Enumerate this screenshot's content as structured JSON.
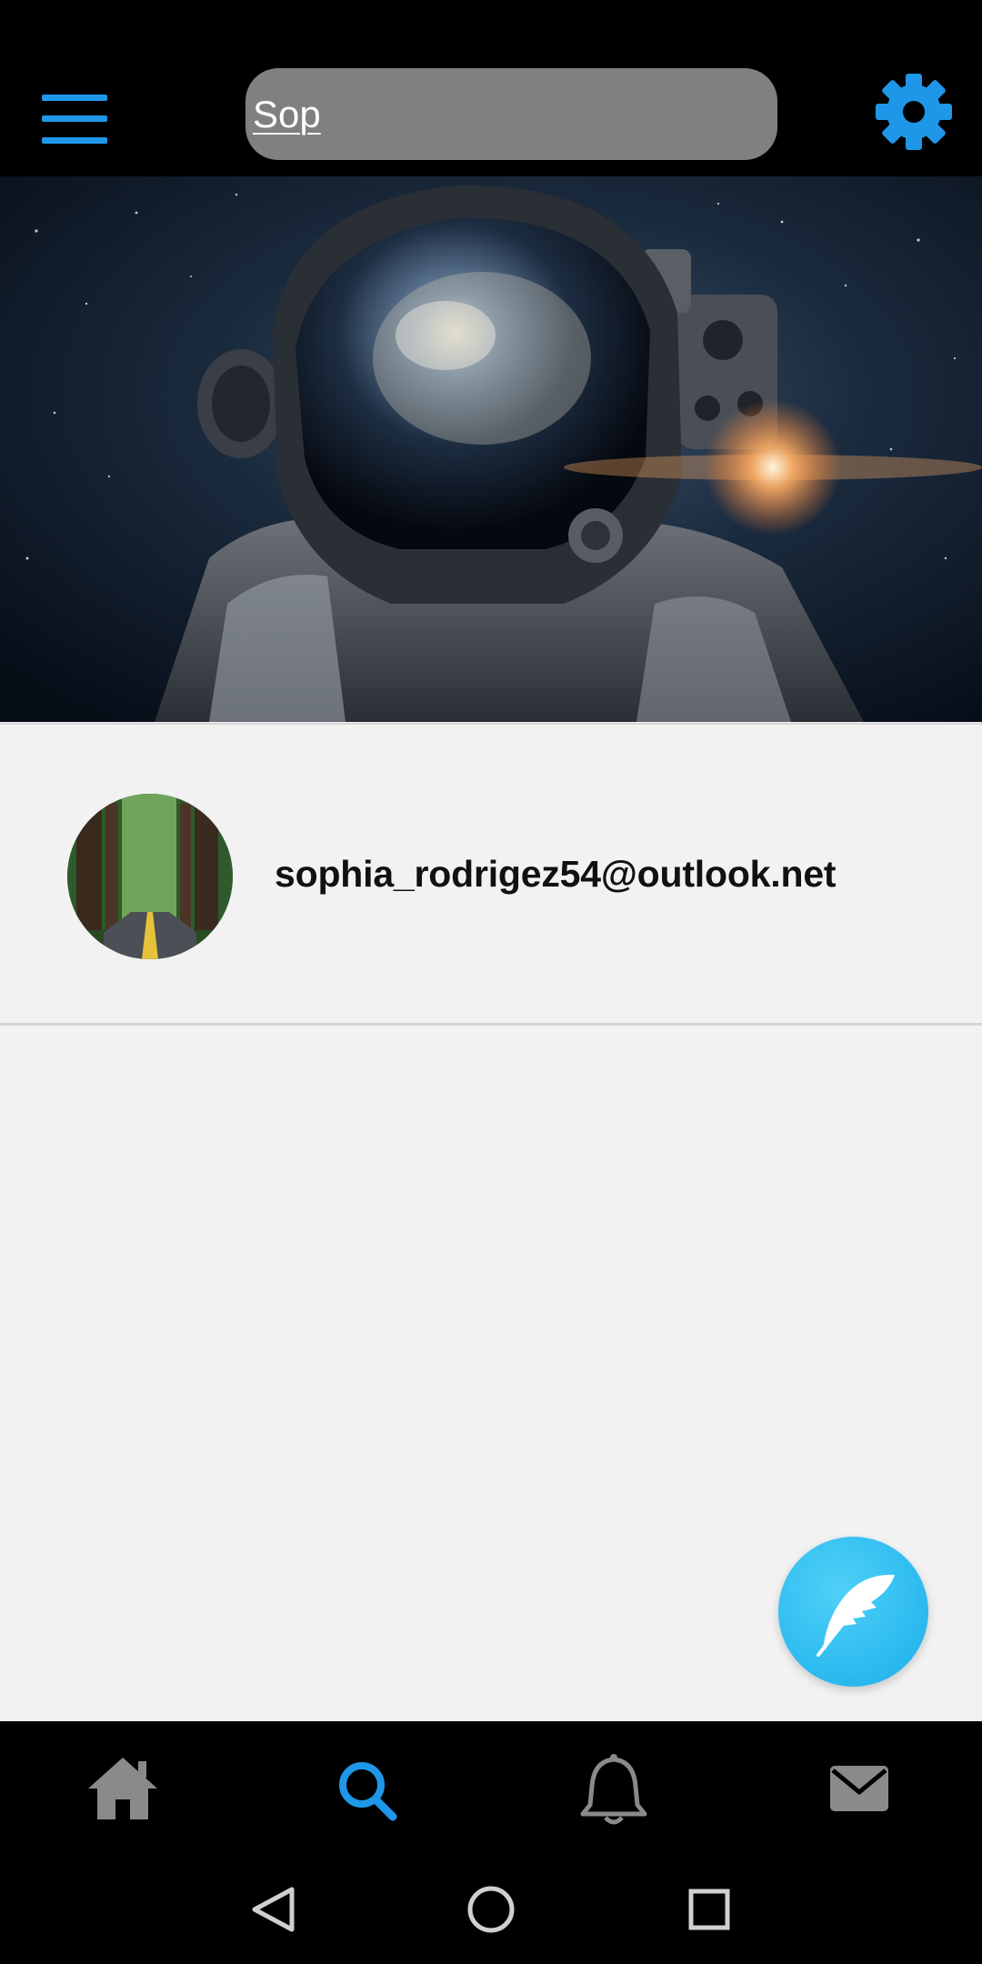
{
  "topbar": {
    "menu_icon": "hamburger-menu-icon",
    "settings_icon": "gear-icon",
    "accent_color": "#1e97e8",
    "search": {
      "value": "Sop",
      "placeholder": ""
    }
  },
  "banner": {
    "image": "astronaut-in-space-banner"
  },
  "result": {
    "email": "sophia_rodrigez54@outlook.net",
    "avatar": "forest-road-avatar"
  },
  "fab": {
    "icon": "feather-quill-icon",
    "color": "#2ab9ef"
  },
  "tabbar": {
    "tabs": [
      {
        "icon": "home-icon",
        "active": false
      },
      {
        "icon": "search-icon",
        "active": true
      },
      {
        "icon": "bell-icon",
        "active": false
      },
      {
        "icon": "mail-icon",
        "active": false
      }
    ],
    "active_color": "#1e97e8",
    "inactive_color": "#8a8a8a"
  },
  "system_nav": {
    "buttons": [
      "back-triangle-icon",
      "home-circle-icon",
      "recents-square-icon"
    ]
  }
}
